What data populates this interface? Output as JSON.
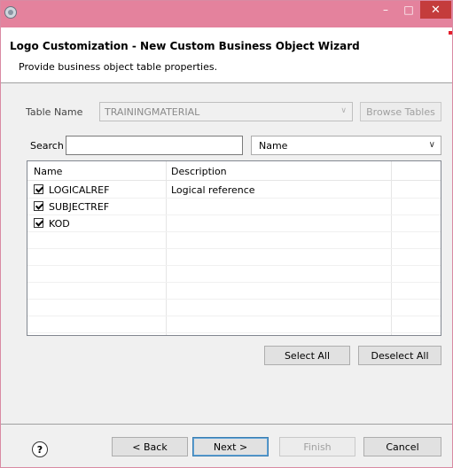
{
  "window": {
    "title_bar": {
      "minimize_label": "–",
      "maximize_label": "□",
      "close_label": "✕",
      "accent": "#e4829d",
      "close_color": "#c43c3c"
    }
  },
  "header": {
    "title": "Logo Customization - New Custom Business Object Wizard",
    "subtitle": "Provide business object table properties."
  },
  "table_name": {
    "label": "Table Name",
    "value": "TRAININGMATERIAL",
    "browse_label": "Browse Tables"
  },
  "search": {
    "label": "Search",
    "value": "",
    "field_select": "Name"
  },
  "grid": {
    "columns": [
      "Name",
      "Description"
    ],
    "rows": [
      {
        "checked": true,
        "name": "LOGICALREF",
        "description": "Logical reference"
      },
      {
        "checked": true,
        "name": "SUBJECTREF",
        "description": ""
      },
      {
        "checked": true,
        "name": "KOD",
        "description": ""
      }
    ]
  },
  "selection_buttons": {
    "select_all": "Select All",
    "deselect_all": "Deselect All"
  },
  "nav_buttons": {
    "back": "< Back",
    "next": "Next >",
    "finish": "Finish",
    "cancel": "Cancel"
  },
  "icons": {
    "app": "gear-icon",
    "help": "help-icon",
    "check": "check-icon"
  }
}
